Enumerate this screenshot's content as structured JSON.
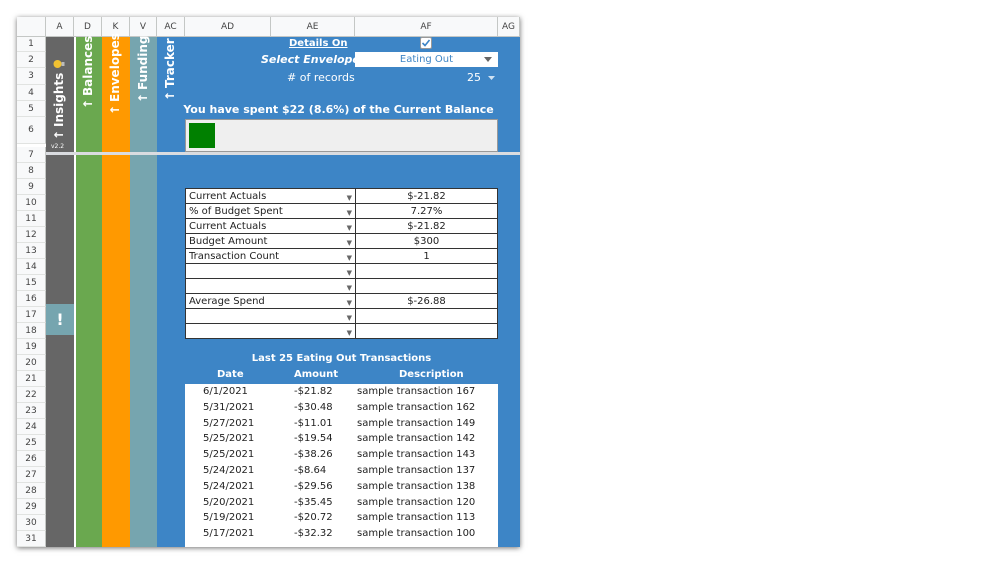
{
  "columns": [
    "A",
    "D",
    "K",
    "V",
    "AC",
    "AD",
    "AE",
    "AF",
    "AG"
  ],
  "rows": [
    "1",
    "2",
    "3",
    "4",
    "5",
    "6",
    "7",
    "8",
    "9",
    "10",
    "11",
    "12",
    "13",
    "14",
    "15",
    "16",
    "17",
    "18",
    "19",
    "20",
    "21",
    "22",
    "23",
    "24",
    "25",
    "26",
    "27",
    "28",
    "29",
    "30",
    "31"
  ],
  "tabs": {
    "insights": "Insights",
    "version": "v2.2",
    "balances": "Balances",
    "envelopes": "Envelopes",
    "funding": "Funding",
    "tracker": "Tracker",
    "arrow": "↑",
    "alert": "!"
  },
  "controls": {
    "details_label": "Details On",
    "details_checked": true,
    "envelope_label": "Select Envelope",
    "envelope_value": "Eating Out",
    "records_label": "# of records",
    "records_value": "25"
  },
  "summary": {
    "spent_text": "You have spent $22 (8.6%) of the Current Balance",
    "progress_fraction": 0.086,
    "bar_color": "#008000"
  },
  "metrics": [
    {
      "label": "Current Actuals",
      "value": "$-21.82"
    },
    {
      "label": "% of Budget Spent",
      "value": "7.27%"
    },
    {
      "label": "Current Actuals",
      "value": "$-21.82"
    },
    {
      "label": "Budget Amount",
      "value": "$300"
    },
    {
      "label": "Transaction Count",
      "value": "1"
    },
    {
      "label": "",
      "value": ""
    },
    {
      "label": "",
      "value": ""
    },
    {
      "label": "Average Spend",
      "value": "$-26.88"
    },
    {
      "label": "",
      "value": ""
    },
    {
      "label": "",
      "value": ""
    }
  ],
  "transactions": {
    "title": "Last 25 Eating Out Transactions",
    "headers": {
      "date": "Date",
      "amount": "Amount",
      "description": "Description"
    },
    "rows": [
      {
        "date": "6/1/2021",
        "amount": "-$21.82",
        "description": "sample transaction 167"
      },
      {
        "date": "5/31/2021",
        "amount": "-$30.48",
        "description": "sample transaction 162"
      },
      {
        "date": "5/27/2021",
        "amount": "-$11.01",
        "description": "sample transaction 149"
      },
      {
        "date": "5/25/2021",
        "amount": "-$19.54",
        "description": "sample transaction 142"
      },
      {
        "date": "5/25/2021",
        "amount": "-$38.26",
        "description": "sample transaction 143"
      },
      {
        "date": "5/24/2021",
        "amount": "-$8.64",
        "description": "sample transaction 137"
      },
      {
        "date": "5/24/2021",
        "amount": "-$29.56",
        "description": "sample transaction 138"
      },
      {
        "date": "5/20/2021",
        "amount": "-$35.45",
        "description": "sample transaction 120"
      },
      {
        "date": "5/19/2021",
        "amount": "-$20.72",
        "description": "sample transaction 113"
      },
      {
        "date": "5/17/2021",
        "amount": "-$32.32",
        "description": "sample transaction 100"
      }
    ]
  },
  "colors": {
    "insights": "#666666",
    "balances": "#6aa84f",
    "envelopes": "#ff9900",
    "funding": "#76a5af",
    "panel": "#3d85c6",
    "alert": "#76a5af"
  }
}
